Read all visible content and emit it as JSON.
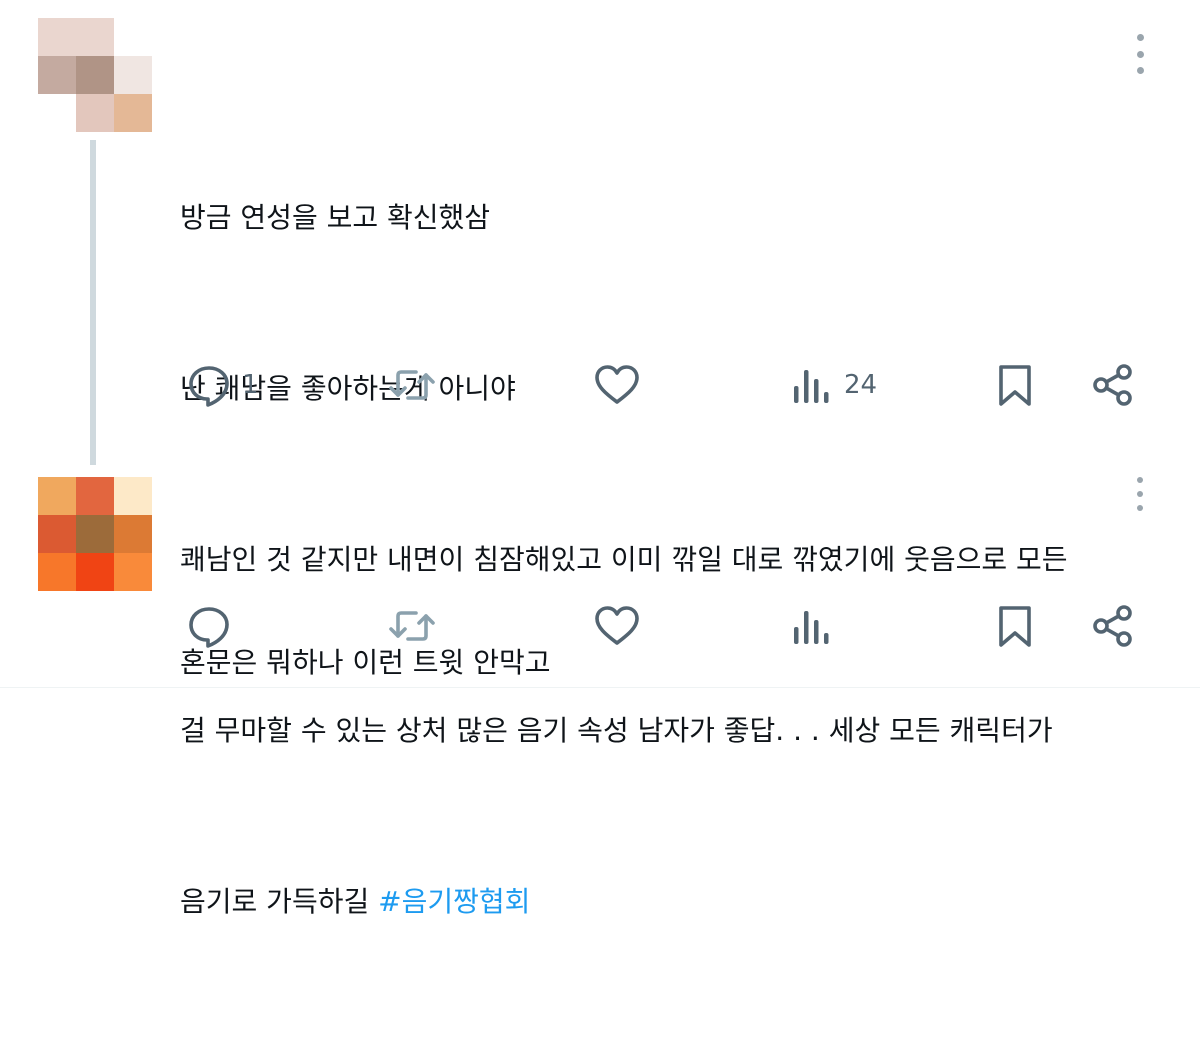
{
  "tweets": [
    {
      "avatar_colors": [
        "#ead6cf",
        "#ead6cf",
        "#ffffff",
        "#c4aaa0",
        "#b09486",
        "#f0e6e2",
        "#ffffff",
        "#e3c7bd",
        "#e4b896"
      ],
      "lines": [
        "방금 연성을 보고 확신했삼",
        "난 쾌남을 좋아하는게 아니야",
        "쾌남인 것 같지만 내면이 침잠해있고 이미 깎일 대로 깎였기에 웃음으로 모든",
        "걸 무마할 수 있는 상처 많은 음기 속성 남자가 좋답. . . 세상 모든 캐릭터가"
      ],
      "last_line_text": "음기로 가득하길 ",
      "hashtag": "#음기짱협회",
      "reply_count": "1",
      "view_count": "24"
    },
    {
      "avatar_colors": [
        "#f0a85e",
        "#e2663f",
        "#fde9c8",
        "#db5a32",
        "#9c6b3a",
        "#dc7a34",
        "#f7772a",
        "#f04414",
        "#f98a3a"
      ],
      "lines": [
        "혼문은 뭐하나 이런 트윗 안막고"
      ],
      "reply_count": "",
      "view_count": ""
    }
  ],
  "icons": {
    "reply": "reply-bubble-icon",
    "retweet": "retweet-icon",
    "like": "heart-icon",
    "views": "views-bar-chart-icon",
    "bookmark": "bookmark-icon",
    "share": "share-icon",
    "more": "more-vertical-icon"
  },
  "colors": {
    "hashtag": "#1d9bf0",
    "icon": "#536471",
    "icon_faded": "#8ba1ad",
    "thread_line": "#cfd9de"
  }
}
